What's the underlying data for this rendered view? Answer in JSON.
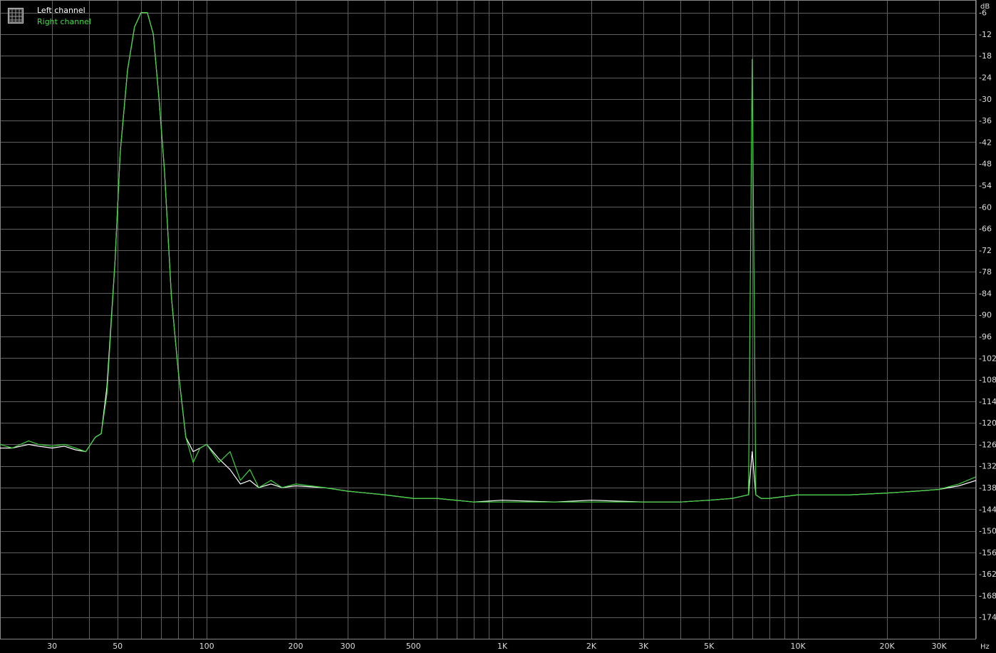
{
  "chart_data": {
    "type": "line",
    "title": "",
    "xlabel": "",
    "ylabel": "",
    "x_unit": "Hz",
    "y_unit": "dB",
    "x_scale": "log",
    "xlim": [
      20,
      40000
    ],
    "ylim": [
      -180,
      -2.5
    ],
    "grid": true,
    "legend_position": "top-left",
    "background_color": "#000000",
    "grid_color": "#5f5f5f",
    "label_color": "#dddddd",
    "x_ticks": [
      {
        "value": 30,
        "label": "30"
      },
      {
        "value": 50,
        "label": "50"
      },
      {
        "value": 100,
        "label": "100"
      },
      {
        "value": 200,
        "label": "200"
      },
      {
        "value": 300,
        "label": "300"
      },
      {
        "value": 500,
        "label": "500"
      },
      {
        "value": 1000,
        "label": "1K"
      },
      {
        "value": 2000,
        "label": "2K"
      },
      {
        "value": 3000,
        "label": "3K"
      },
      {
        "value": 5000,
        "label": "5K"
      },
      {
        "value": 10000,
        "label": "10K"
      },
      {
        "value": 20000,
        "label": "20K"
      },
      {
        "value": 30000,
        "label": "30K"
      }
    ],
    "y_ticks": [
      -6,
      -12,
      -18,
      -24,
      -30,
      -36,
      -42,
      -48,
      -54,
      -60,
      -66,
      -72,
      -78,
      -84,
      -90,
      -96,
      -102,
      -108,
      -114,
      -120,
      -126,
      -132,
      -138,
      -144,
      -150,
      -156,
      -162,
      -168,
      -174
    ],
    "series": [
      {
        "name": "Left channel",
        "color": "#ffffff",
        "x": [
          20,
          22,
          25,
          27,
          30,
          33,
          36,
          39,
          42,
          44,
          46,
          49,
          51,
          54,
          57,
          60,
          63,
          66,
          69,
          72,
          76,
          80,
          85,
          90,
          95,
          100,
          110,
          120,
          130,
          140,
          150,
          165,
          180,
          200,
          250,
          300,
          400,
          500,
          600,
          800,
          1000,
          1500,
          2000,
          3000,
          4000,
          5000,
          6000,
          6800,
          7000,
          7200,
          7500,
          8000,
          10000,
          12000,
          15000,
          20000,
          25000,
          30000,
          35000,
          40000
        ],
        "y": [
          -127,
          -127,
          -126,
          -126.5,
          -127,
          -126.5,
          -127.5,
          -128,
          -124,
          -123,
          -110,
          -75,
          -45,
          -22,
          -10,
          -6,
          -6,
          -12,
          -30,
          -50,
          -85,
          -105,
          -124,
          -128,
          -127,
          -126,
          -130,
          -133,
          -137,
          -136,
          -138,
          -137,
          -138,
          -137.5,
          -138,
          -139,
          -140,
          -141,
          -141,
          -142,
          -141.5,
          -142,
          -141.5,
          -142,
          -142,
          -141.5,
          -141,
          -140,
          -128,
          -140,
          -141,
          -141,
          -140,
          -140,
          -140,
          -139.5,
          -139,
          -138.5,
          -137.5,
          -136
        ]
      },
      {
        "name": "Right channel",
        "color": "#3fd23f",
        "x": [
          20,
          22,
          25,
          27,
          30,
          33,
          36,
          39,
          42,
          44,
          46,
          49,
          51,
          54,
          57,
          60,
          63,
          66,
          69,
          72,
          76,
          80,
          85,
          90,
          95,
          100,
          110,
          120,
          130,
          140,
          150,
          165,
          180,
          200,
          250,
          300,
          400,
          500,
          600,
          800,
          1000,
          1500,
          2000,
          3000,
          4000,
          5000,
          6000,
          6800,
          7000,
          7200,
          7500,
          8000,
          10000,
          12000,
          15000,
          20000,
          25000,
          30000,
          35000,
          40000
        ],
        "y": [
          -126,
          -127,
          -125,
          -126,
          -126.5,
          -126,
          -127,
          -128,
          -124,
          -123,
          -112,
          -75,
          -45,
          -22,
          -10,
          -6,
          -6,
          -12,
          -30,
          -50,
          -85,
          -105,
          -124,
          -131,
          -127,
          -126,
          -131,
          -128,
          -136,
          -133,
          -138,
          -136,
          -138,
          -137,
          -138,
          -139,
          -140,
          -141,
          -141,
          -142,
          -142,
          -142,
          -142,
          -142,
          -142,
          -141.5,
          -141,
          -140,
          -19,
          -140,
          -141,
          -141,
          -140,
          -140,
          -140,
          -139.5,
          -139,
          -138.5,
          -137,
          -135
        ]
      }
    ]
  }
}
